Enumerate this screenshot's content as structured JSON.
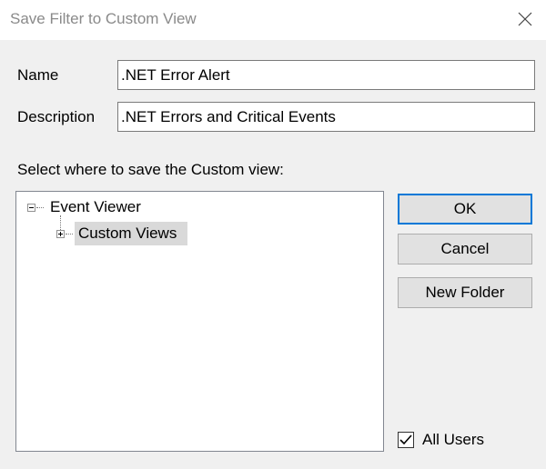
{
  "window": {
    "title": "Save Filter to Custom View"
  },
  "form": {
    "name_label": "Name",
    "name_value": ".NET Error Alert",
    "description_label": "Description",
    "description_value": ".NET Errors and Critical Events",
    "select_location_label": "Select where to save the Custom view:"
  },
  "tree": {
    "root": {
      "label": "Event Viewer",
      "expanded": true
    },
    "child": {
      "label": "Custom Views",
      "expanded": false,
      "selected": true
    }
  },
  "buttons": {
    "ok_label": "OK",
    "cancel_label": "Cancel",
    "new_folder_label": "New Folder"
  },
  "options": {
    "all_users_label": "All Users",
    "all_users_checked": true
  },
  "icons": {
    "close": "close-icon",
    "collapse": "minus-box-icon",
    "expand": "plus-box-icon",
    "check": "checkmark-icon"
  },
  "colors": {
    "dialog_bg": "#f0f0f0",
    "default_button_border": "#0078d7",
    "selection_bg": "#d9d9d9"
  }
}
